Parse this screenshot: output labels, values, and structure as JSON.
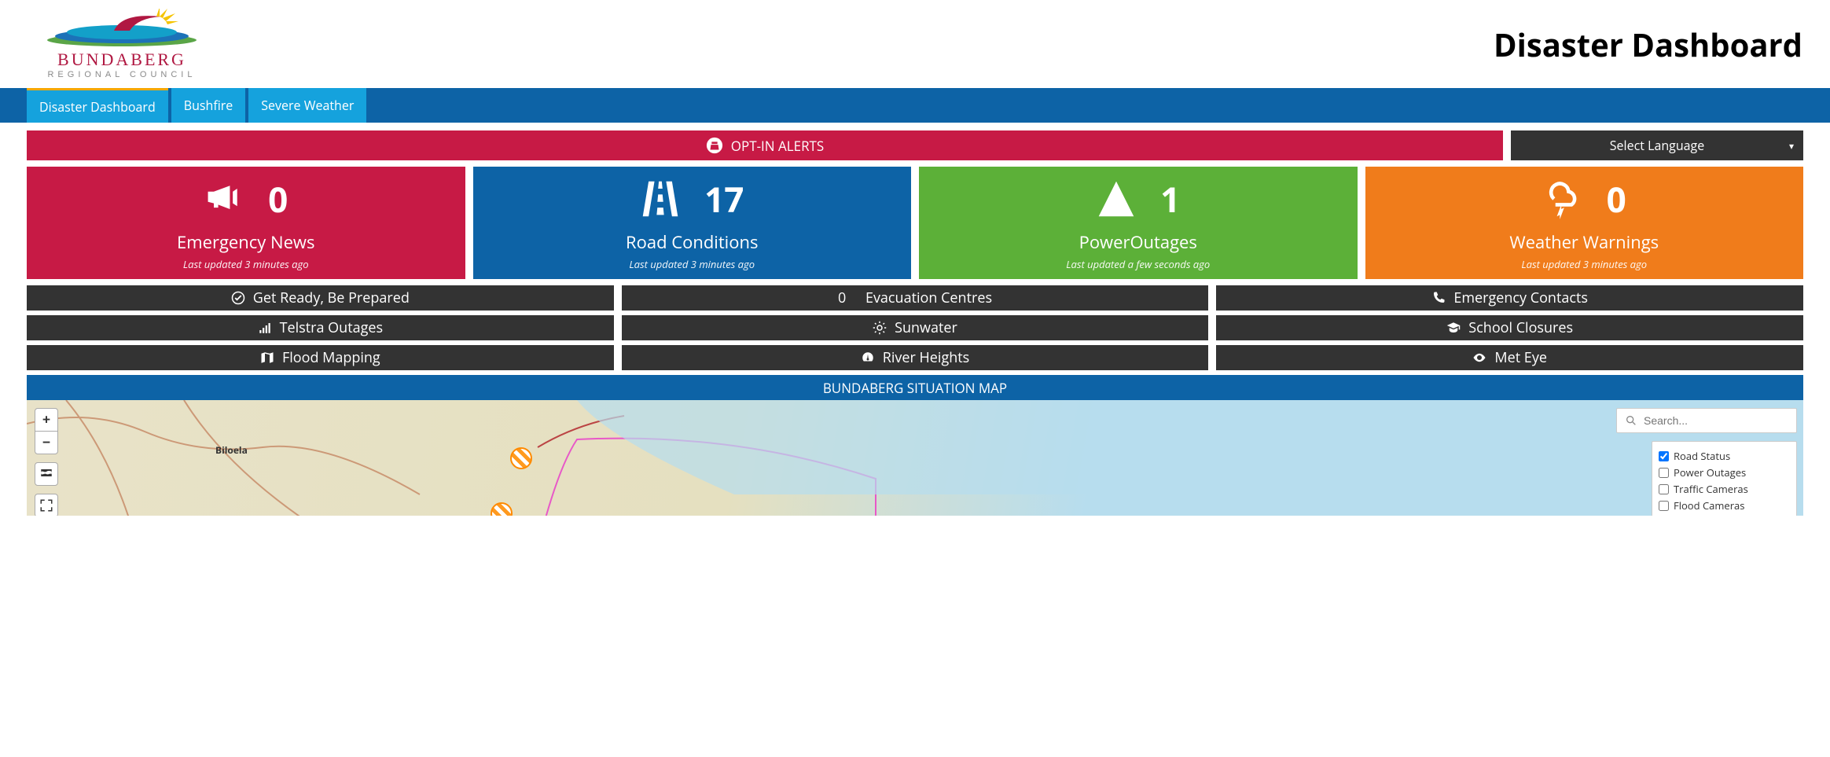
{
  "header": {
    "org_name": "BUNDABERG",
    "org_sub": "REGIONAL COUNCIL",
    "page_title": "Disaster Dashboard"
  },
  "nav": {
    "tabs": [
      {
        "label": "Disaster Dashboard",
        "active": true
      },
      {
        "label": "Bushfire",
        "active": false
      },
      {
        "label": "Severe Weather",
        "active": false
      }
    ]
  },
  "opt_in": {
    "label": "OPT-IN ALERTS"
  },
  "language": {
    "selected": "Select Language"
  },
  "stats": [
    {
      "count": "0",
      "label": "Emergency News",
      "updated": "Last updated 3 minutes ago",
      "color": "c-red",
      "icon": "megaphone"
    },
    {
      "count": "17",
      "label": "Road Conditions",
      "updated": "Last updated 3 minutes ago",
      "color": "c-blue",
      "icon": "road"
    },
    {
      "count": "1",
      "label": "PowerOutages",
      "updated": "Last updated a few seconds ago",
      "color": "c-green",
      "icon": "power"
    },
    {
      "count": "0",
      "label": "Weather Warnings",
      "updated": "Last updated 3 minutes ago",
      "color": "c-orange",
      "icon": "storm"
    }
  ],
  "links": {
    "row1": [
      {
        "icon": "check",
        "label": "Get Ready, Be Prepared"
      },
      {
        "icon": "",
        "prefix": "0",
        "label": "Evacuation Centres"
      },
      {
        "icon": "phone",
        "label": "Emergency Contacts"
      }
    ],
    "row2": [
      {
        "icon": "signal",
        "label": "Telstra Outages"
      },
      {
        "icon": "sun",
        "label": "Sunwater"
      },
      {
        "icon": "gradcap",
        "label": "School Closures"
      }
    ],
    "row3": [
      {
        "icon": "map",
        "label": "Flood Mapping"
      },
      {
        "icon": "gauge",
        "label": "River Heights"
      },
      {
        "icon": "eye",
        "label": "Met Eye"
      }
    ]
  },
  "map": {
    "title": "BUNDABERG SITUATION MAP",
    "search_placeholder": "Search...",
    "town_label": "Biloela",
    "layers": [
      {
        "label": "Road Status",
        "checked": true
      },
      {
        "label": "Power Outages",
        "checked": false
      },
      {
        "label": "Traffic Cameras",
        "checked": false
      },
      {
        "label": "Flood Cameras",
        "checked": false
      }
    ]
  }
}
